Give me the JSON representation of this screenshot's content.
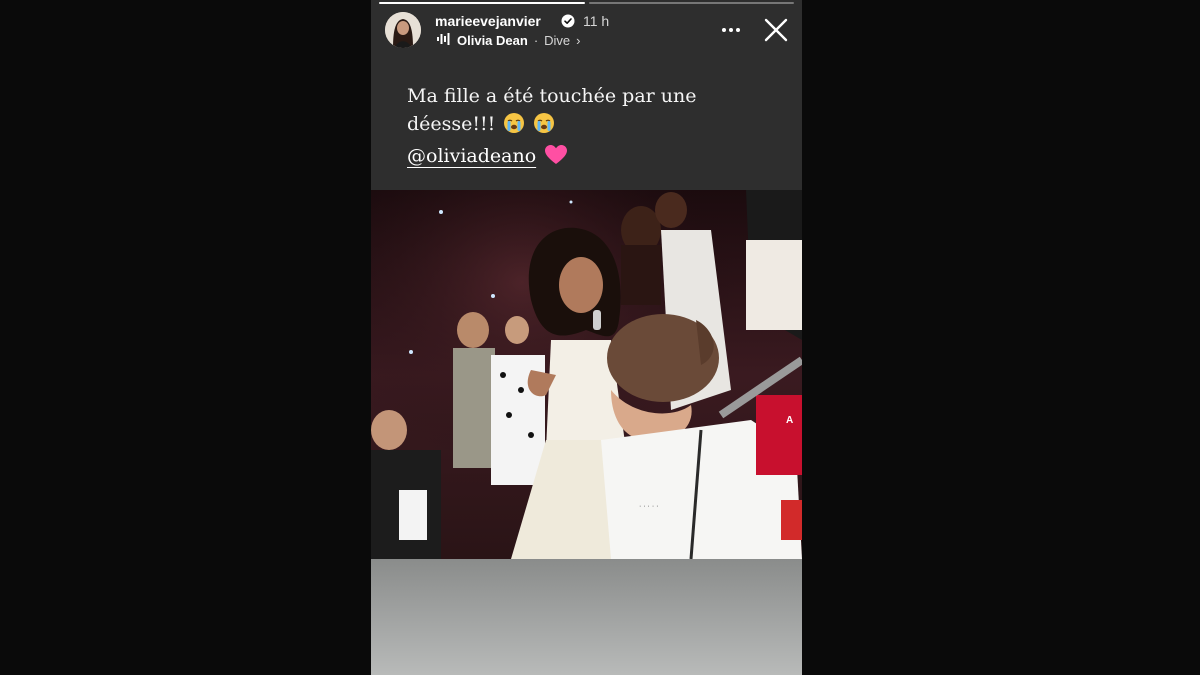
{
  "story": {
    "username": "marieevejanvier",
    "time_ago": "11 h",
    "verified": true,
    "music": {
      "artist": "Olivia Dean",
      "separator": "·",
      "track": "Dive",
      "chevron": "›"
    },
    "progress_segments": [
      1.0,
      0.0
    ],
    "caption": {
      "line1": "Ma fille a été touchée par une",
      "line2": "déesse!!!",
      "mention": "@oliviadeano"
    },
    "icons": {
      "more": "more-horizontal-icon",
      "close": "close-icon",
      "verified": "verified-badge-icon",
      "music": "sound-wave-icon",
      "emoji1": "loudly-crying-face-emoji",
      "emoji2": "loudly-crying-face-emoji",
      "heart": "pink-heart-emoji"
    },
    "colors": {
      "story_bg": "#2e2e2e",
      "page_bg": "#0a0a0a",
      "heart": "#ff4fa3",
      "verified": "#ffffff"
    }
  }
}
